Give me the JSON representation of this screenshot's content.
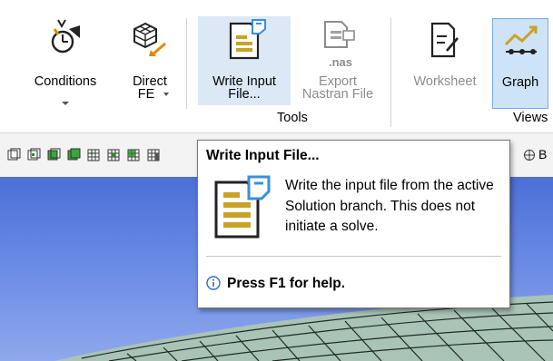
{
  "ribbon": {
    "buttons": [
      {
        "id": "conditions",
        "label": "Conditions",
        "state": "normal"
      },
      {
        "id": "direct_fe",
        "label_line1": "Direct",
        "label_line2": "FE",
        "state": "normal"
      },
      {
        "id": "write_input",
        "label_line1": "Write Input",
        "label_line2": "File...",
        "state": "hover"
      },
      {
        "id": "export_nastran",
        "label_line1": "Export",
        "label_line2": "Nastran File",
        "icon_text": ".nas",
        "state": "disabled"
      },
      {
        "id": "worksheet",
        "label": "Worksheet",
        "state": "disabled"
      },
      {
        "id": "graph",
        "label": "Graph",
        "state": "selected"
      }
    ],
    "groups": {
      "tools": "Tools",
      "views": "Views"
    }
  },
  "toolbar": {
    "partial_label": "B"
  },
  "tooltip": {
    "title": "Write Input File...",
    "body": "Write the input file from the active Solution branch. This does not initiate a solve.",
    "help": "Press F1 for help."
  },
  "colors": {
    "accent": "#3a8fdc",
    "icon_gold": "#c9a227",
    "viewport": "#5b7ee0",
    "mesh": "#a9c3b7"
  }
}
